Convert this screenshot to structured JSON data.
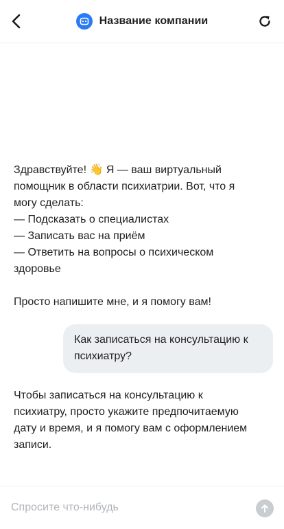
{
  "header": {
    "title": "Название компании",
    "back_icon": "chevron-left-icon",
    "bot_icon": "chat-bot-icon",
    "refresh_icon": "refresh-icon"
  },
  "messages": [
    {
      "role": "bot",
      "lines": [
        "Здравствуйте! 👋 Я — ваш виртуальный",
        "помощник в области психиатрии. Вот, что я",
        "могу сделать:",
        "— Подсказать о специалистах",
        "— Записать вас на приём",
        "— Ответить на вопросы о психическом",
        "здоровье",
        "",
        "Просто напишите мне, и я помогу вам!"
      ]
    },
    {
      "role": "user",
      "lines": [
        "Как записаться на консультацию к",
        "психиатру?"
      ]
    },
    {
      "role": "bot",
      "lines": [
        "Чтобы записаться на консультацию к",
        "психиатру, просто укажите предпочитаемую",
        "дату и время, и я помогу вам с оформлением",
        "записи."
      ]
    }
  ],
  "composer": {
    "placeholder": "Спросите что-нибудь",
    "value": "",
    "send_icon": "send-arrow-up-icon"
  },
  "colors": {
    "accent": "#2b7cf4",
    "user_bubble": "#eceff2",
    "send_disabled": "#c9ccd1"
  }
}
